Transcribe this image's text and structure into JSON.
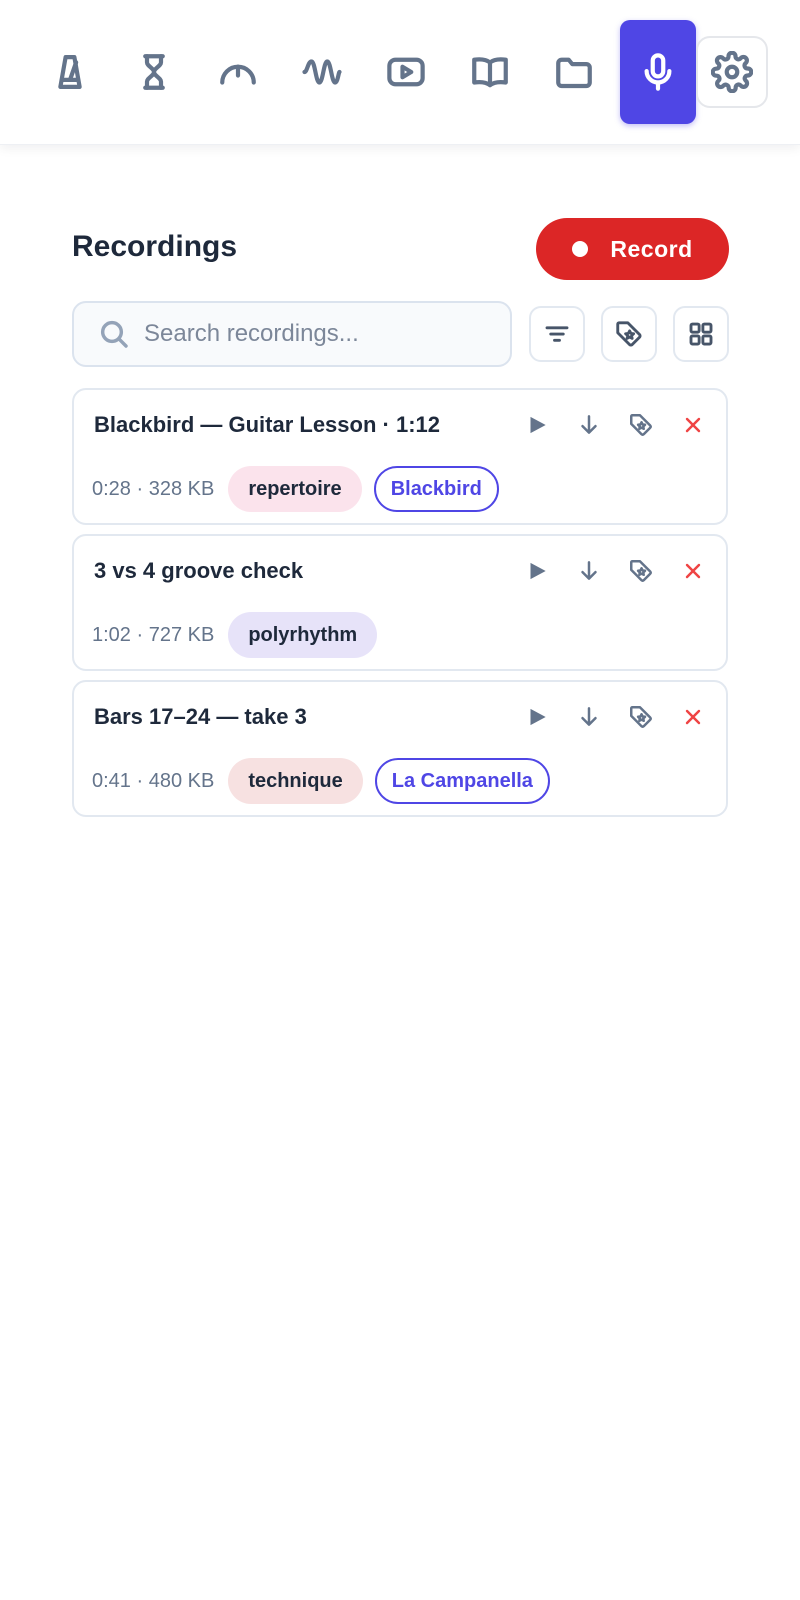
{
  "nav": {
    "items": [
      {
        "name": "metronome-icon",
        "active": false
      },
      {
        "name": "hourglass-icon",
        "active": false
      },
      {
        "name": "tuner-gauge-icon",
        "active": false
      },
      {
        "name": "waveform-icon",
        "active": false
      },
      {
        "name": "video-icon",
        "active": false
      },
      {
        "name": "book-icon",
        "active": false
      },
      {
        "name": "folder-icon",
        "active": false
      },
      {
        "name": "microphone-icon",
        "active": true
      },
      {
        "name": "gear-icon",
        "active": false
      }
    ]
  },
  "header": {
    "title": "Recordings",
    "record_label": "Record"
  },
  "search": {
    "placeholder": "Search recordings...",
    "value": ""
  },
  "toolbar": {
    "icons": [
      "filter-icon",
      "tag-icon",
      "grid-view-icon"
    ]
  },
  "recordings": [
    {
      "title": "Blackbird — Guitar Lesson · 1:12",
      "meta": "0:28 · 328 KB",
      "category": {
        "label": "repertoire",
        "color": "#fbe3ec"
      },
      "piece": "Blackbird"
    },
    {
      "title": "3 vs 4 groove check",
      "meta": "1:02 · 727 KB",
      "category": {
        "label": "polyrhythm",
        "color": "#e7e3f9"
      },
      "piece": null
    },
    {
      "title": "Bars 17–24 — take 3",
      "meta": "0:41 · 480 KB",
      "category": {
        "label": "technique",
        "color": "#f7e1e1"
      },
      "piece": "La Campanella"
    }
  ],
  "colors": {
    "accent": "#4f46e5",
    "record": "#dc2626",
    "delete": "#ef4444",
    "text": "#1e293b",
    "muted": "#64748b"
  }
}
